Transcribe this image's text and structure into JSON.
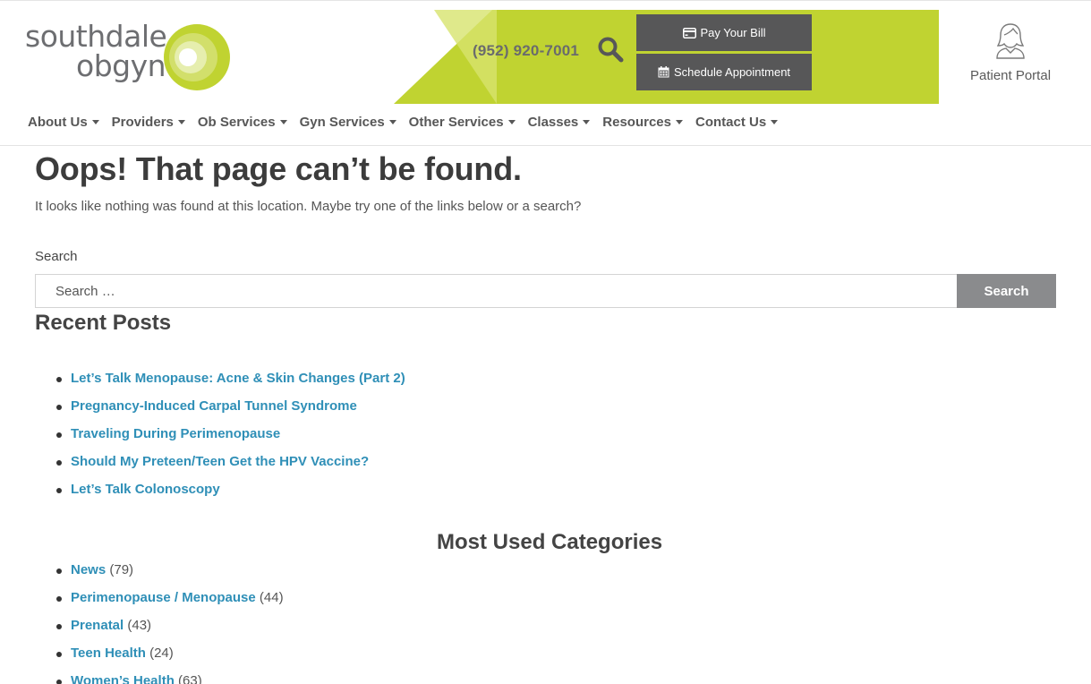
{
  "brand": {
    "logo_line1": "southdale",
    "logo_line2": "obgyn",
    "colors": {
      "accent_green": "#c0d331",
      "dark_button": "#575758",
      "link_blue": "#2f8fb7"
    }
  },
  "header": {
    "phone": "(952) 920-7001",
    "search_icon": "search-icon",
    "pay_bill_label": "Pay Your Bill",
    "schedule_label": "Schedule Appointment",
    "portal_label": "Patient Portal"
  },
  "nav": {
    "items": [
      {
        "label": "About Us"
      },
      {
        "label": "Providers"
      },
      {
        "label": "Ob Services"
      },
      {
        "label": "Gyn Services"
      },
      {
        "label": "Other Services"
      },
      {
        "label": "Classes"
      },
      {
        "label": "Resources"
      },
      {
        "label": "Contact Us"
      }
    ]
  },
  "main": {
    "title": "Oops! That page can’t be found.",
    "intro": "It looks like nothing was found at this location. Maybe try one of the links below or a search?",
    "search": {
      "label": "Search",
      "placeholder": "Search …",
      "value": "",
      "button": "Search"
    },
    "recent": {
      "heading": "Recent Posts",
      "posts": [
        "Let’s Talk Menopause: Acne & Skin Changes (Part 2)",
        "Pregnancy-Induced Carpal Tunnel Syndrome",
        "Traveling During Perimenopause",
        "Should My Preteen/Teen Get the HPV Vaccine?",
        "Let’s Talk Colonoscopy"
      ]
    },
    "categories": {
      "heading": "Most Used Categories",
      "items": [
        {
          "label": "News",
          "count": "(79)"
        },
        {
          "label": "Perimenopause / Menopause",
          "count": "(44)"
        },
        {
          "label": "Prenatal",
          "count": "(43)"
        },
        {
          "label": "Teen Health",
          "count": "(24)"
        },
        {
          "label": "Women’s Health",
          "count": "(63)"
        }
      ]
    }
  }
}
